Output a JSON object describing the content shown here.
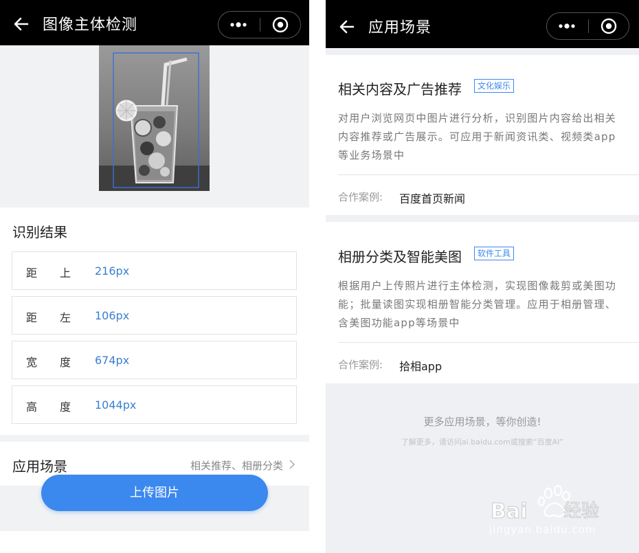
{
  "left_screen": {
    "title": "图像主体检测",
    "result_title": "识别结果",
    "results": [
      {
        "k1": "距",
        "k2": "上",
        "value": "216px"
      },
      {
        "k1": "距",
        "k2": "左",
        "value": "106px"
      },
      {
        "k1": "宽",
        "k2": "度",
        "value": "674px"
      },
      {
        "k1": "高",
        "k2": "度",
        "value": "1044px"
      }
    ],
    "scene_label": "应用场景",
    "scene_summary": "相关推荐、相册分类",
    "upload_button": "上传图片"
  },
  "right_screen": {
    "title": "应用场景",
    "cards": [
      {
        "title": "相关内容及广告推荐",
        "tag": "文化娱乐",
        "desc": "对用户浏览网页中图片进行分析，识别图片内容给出相关内容推荐或广告展示。可应用于新闻资讯类、视频类app等业务场景中",
        "case_label": "合作案例:",
        "case_value": "百度首页新闻"
      },
      {
        "title": "相册分类及智能美图",
        "tag": "软件工具",
        "desc": "根据用户上传照片进行主体检测，实现图像裁剪或美图功能；批量读图实现相册智能分类管理。应用于相册管理、含美图功能app等场景中",
        "case_label": "合作案例:",
        "case_value": "拾相app"
      }
    ],
    "footer_main": "更多应用场景，等你创造!",
    "footer_sub": "了解更多，请访问ai.baidu.com或搜索“百度AI”"
  },
  "watermark": {
    "logo": "Baidu经验",
    "site": "jingyan.baidu.com"
  },
  "icons": {
    "back": "arrow-left-icon",
    "more": "more-dots-icon",
    "close": "target-circle-icon",
    "chevron": "chevron-right-icon"
  },
  "colors": {
    "accent": "#3b88ee",
    "value_blue": "#3a7fd0",
    "titlebar": "#000000",
    "gap_gray": "#f1f2f4"
  }
}
